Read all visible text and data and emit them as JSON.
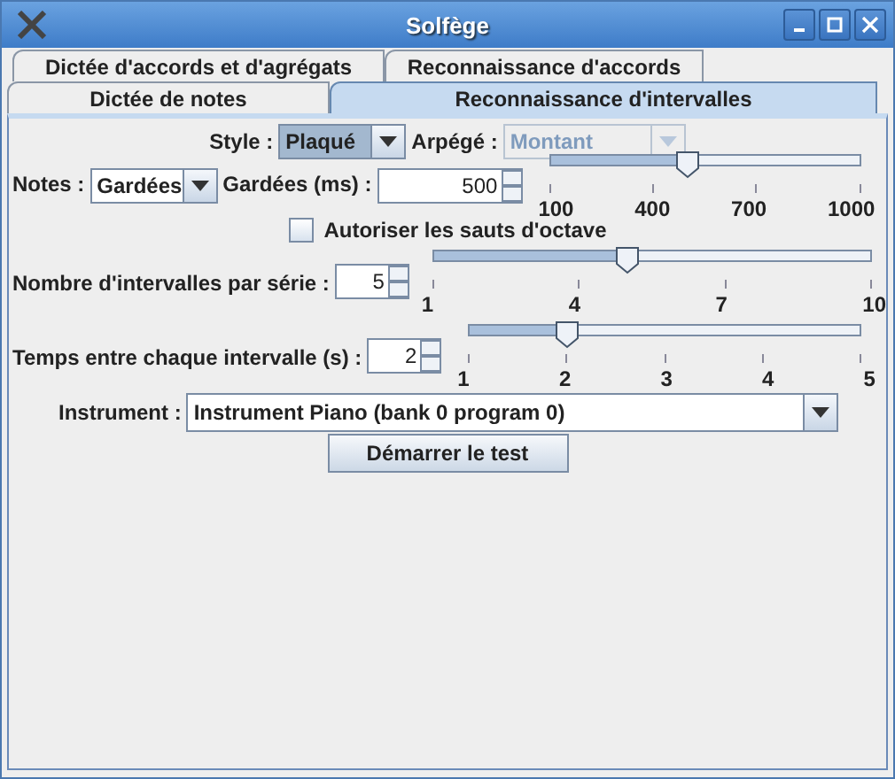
{
  "window": {
    "title": "Solfège"
  },
  "tab_rows": [
    {
      "tabs": [
        {
          "label": "Dictée d'accords et d'agrégats",
          "selected": false
        },
        {
          "label": "Reconnaissance d'accords",
          "selected": false
        }
      ]
    },
    {
      "tabs": [
        {
          "label": "Dictée de notes",
          "selected": false
        },
        {
          "label": "Reconnaissance d'intervalles",
          "selected": true
        }
      ]
    }
  ],
  "style": {
    "label": "Style :",
    "value": "Plaqué"
  },
  "arpeggio": {
    "label": "Arpégé :",
    "value": "Montant",
    "disabled": true
  },
  "notes": {
    "label": "Notes :",
    "value": "Gardées"
  },
  "duration": {
    "label": "Gardées (ms) :",
    "value": "500",
    "slider": {
      "level": 0.444,
      "ticks": [
        "100",
        "400",
        "700",
        "1000"
      ]
    }
  },
  "octave": {
    "label": "Autoriser les sauts d'octave",
    "checked": false
  },
  "count": {
    "label": "Nombre d'intervalles par série :",
    "value": "5",
    "slider": {
      "level": 0.444,
      "ticks": [
        "1",
        "4",
        "7",
        "10"
      ]
    }
  },
  "interval_time": {
    "label": "Temps entre chaque intervalle (s) :",
    "value": "2",
    "slider": {
      "level": 0.25,
      "ticks": [
        "1",
        "2",
        "3",
        "4",
        "5"
      ]
    }
  },
  "instrument": {
    "label": "Instrument :",
    "value": "Instrument Piano (bank 0 program 0)"
  },
  "start_button": "Démarrer le test"
}
